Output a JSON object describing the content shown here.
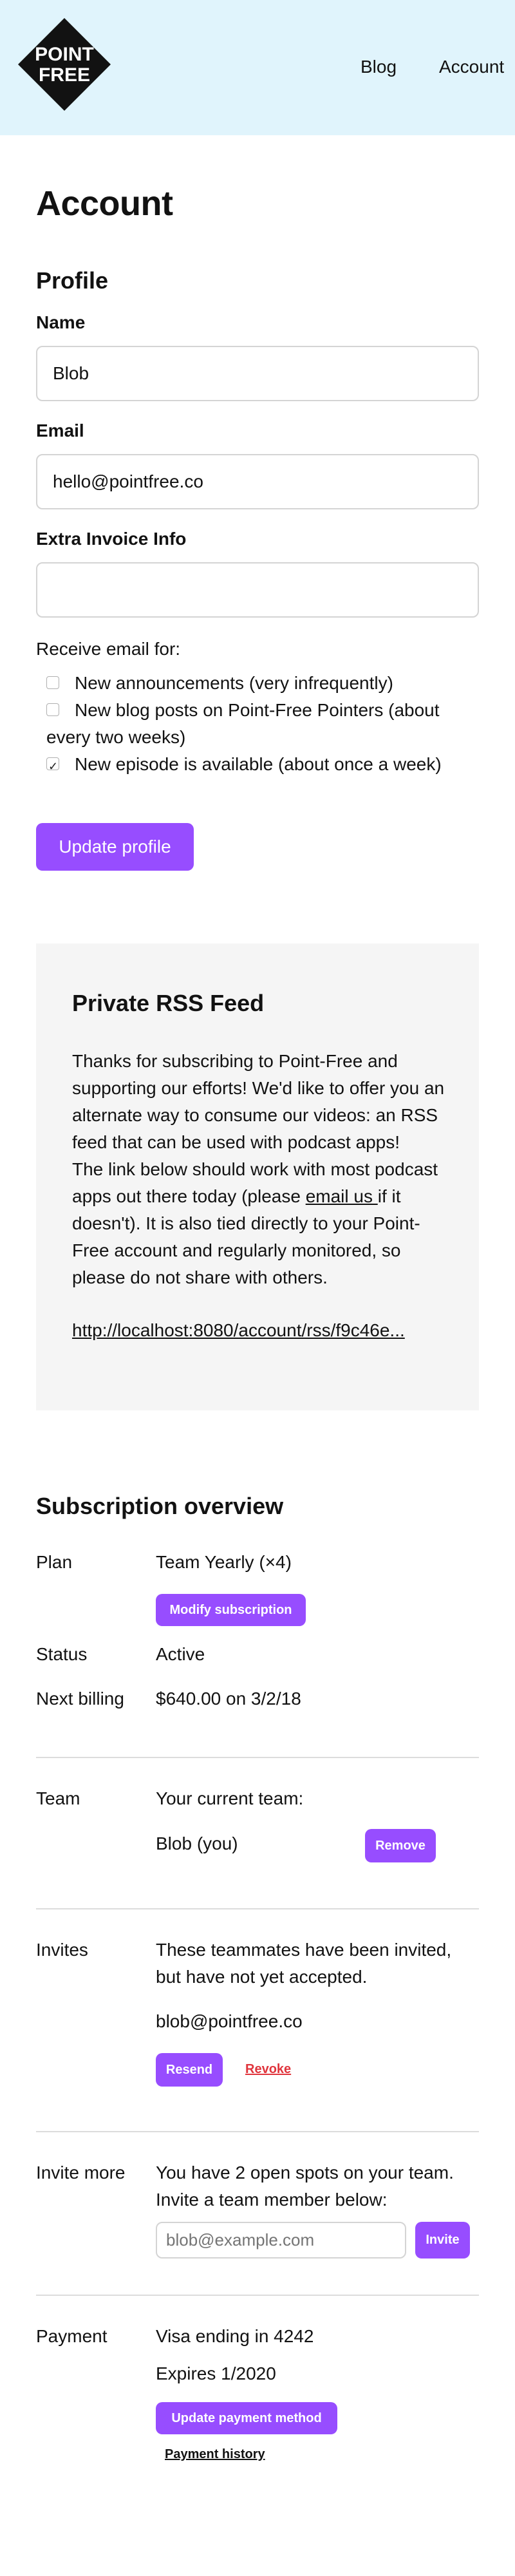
{
  "header": {
    "logo_line1": "POINT",
    "logo_line2": "FREE",
    "nav": {
      "blog": "Blog",
      "account": "Account"
    }
  },
  "page": {
    "title": "Account"
  },
  "profile": {
    "heading": "Profile",
    "name_label": "Name",
    "name_value": "Blob",
    "email_label": "Email",
    "email_value": "hello@pointfree.co",
    "invoice_label": "Extra Invoice Info",
    "invoice_value": "",
    "receive_label": "Receive email for:",
    "options": [
      {
        "label": "New announcements (very infrequently)",
        "checked": false
      },
      {
        "label": "New blog posts on Point-Free Pointers (about every two weeks)",
        "checked": false
      },
      {
        "label": "New episode is available (about once a week)",
        "checked": true
      }
    ],
    "update_button": "Update profile"
  },
  "rss": {
    "heading": "Private RSS Feed",
    "para1": "Thanks for subscribing to Point-Free and supporting our efforts! We'd like to offer you an alternate way to consume our videos: an RSS feed that can be used with podcast apps!",
    "para2_before": "The link below should work with most podcast apps out there today (please ",
    "para2_link": "email us ",
    "para2_after": "if it doesn't). It is also tied directly to your Point-Free account and regularly monitored, so please do not share with others.",
    "feed_link": "http://localhost:8080/account/rss/f9c46e..."
  },
  "subscription": {
    "heading": "Subscription overview",
    "plan_label": "Plan",
    "plan_value": "Team Yearly (×4)",
    "modify_button": "Modify subscription",
    "status_label": "Status",
    "status_value": "Active",
    "billing_label": "Next billing",
    "billing_value": "$640.00 on 3/2/18"
  },
  "team": {
    "label": "Team",
    "intro": "Your current team:",
    "member": "Blob (you)",
    "remove_button": "Remove"
  },
  "invites": {
    "label": "Invites",
    "intro": "These teammates have been invited, but have not yet accepted.",
    "email": "blob@pointfree.co",
    "resend_button": "Resend",
    "revoke_link": "Revoke"
  },
  "invite_more": {
    "label": "Invite more",
    "intro": "You have 2 open spots on your team. Invite a team member below:",
    "placeholder": "blob@example.com",
    "invite_button": "Invite"
  },
  "payment": {
    "label": "Payment",
    "card": "Visa ending in 4242",
    "expires": "Expires 1/2020",
    "update_button": "Update payment method",
    "history_link": "Payment history"
  },
  "colors": {
    "accent": "#974dff",
    "header_bg": "#e0f4fc",
    "danger": "#e0353d",
    "panel_bg": "#f5f5f5"
  }
}
